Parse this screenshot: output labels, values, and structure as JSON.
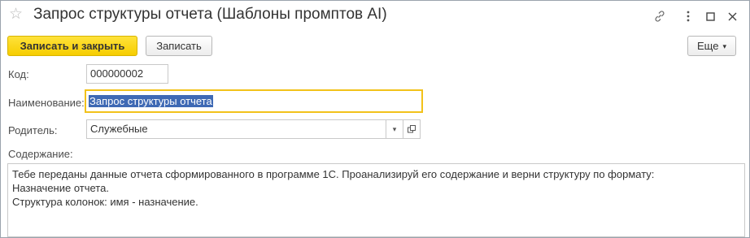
{
  "window": {
    "title": "Запрос структуры отчета (Шаблоны промптов AI)",
    "star_glyph": "☆"
  },
  "toolbar": {
    "save_close_label": "Записать и закрыть",
    "save_label": "Записать",
    "more_label": "Еще",
    "more_arrow": "▾"
  },
  "form": {
    "code_label": "Код:",
    "code_value": "000000002",
    "name_label": "Наименование:",
    "name_value": "Запрос структуры отчета",
    "parent_label": "Родитель:",
    "parent_value": "Служебные",
    "content_label": "Содержание:",
    "content_lines": [
      "Тебе переданы данные отчета сформированного в программе 1С. Проанализируй его содержание и верни структуру по формату:",
      "Назначение отчета.",
      "Структура колонок: имя - назначение."
    ]
  },
  "colors": {
    "primary_button": "#f6cd00",
    "focus_border": "#f2c21a",
    "selection": "#3e69b4"
  }
}
